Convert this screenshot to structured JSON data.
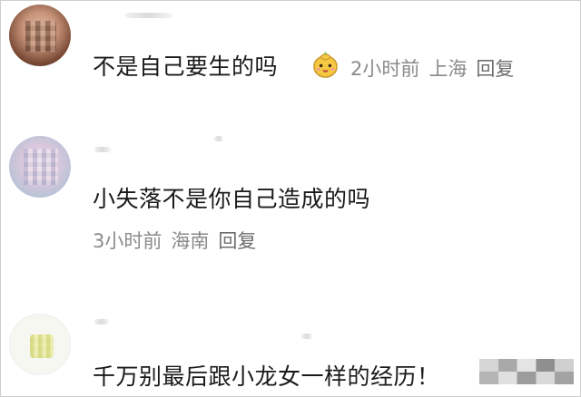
{
  "comments": [
    {
      "avatar": "avatar-mosaic-face",
      "text": "不是自己要生的吗",
      "emoji": "yellow-doll-emoji",
      "time": "2小时前",
      "location": "上海",
      "reply": "回复"
    },
    {
      "avatar": "avatar-mosaic-pastel",
      "text": "小失落不是你自己造成的吗",
      "time": "3小时前",
      "location": "海南",
      "reply": "回复"
    },
    {
      "avatar": "avatar-mosaic-yellow",
      "text": "千万别最后跟小龙女一样的经历！"
    }
  ],
  "colors": {
    "text": "#1a1a1a",
    "meta": "#8a8a8a",
    "background": "#ffffff"
  }
}
